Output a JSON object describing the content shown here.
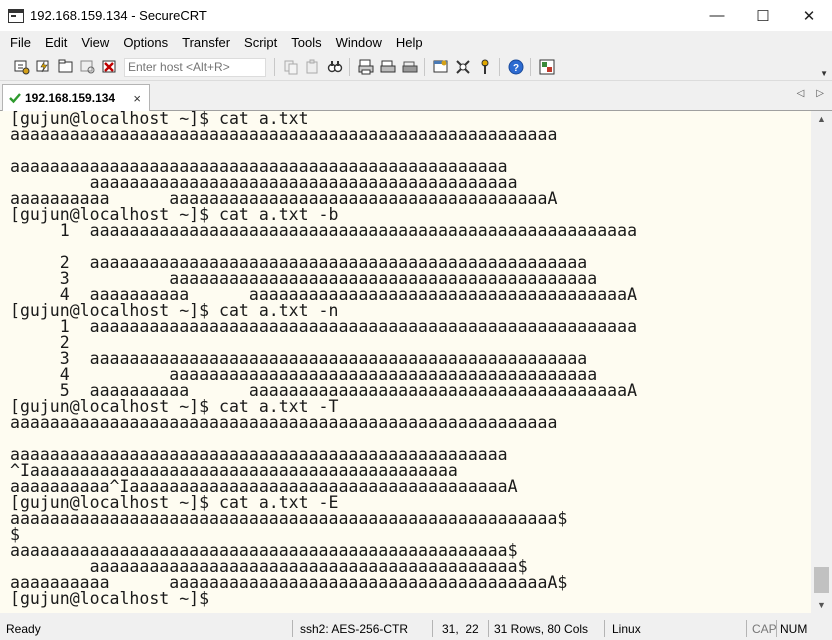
{
  "window": {
    "title": "192.168.159.134 - SecureCRT",
    "minimize": "—",
    "maximize": "☐",
    "close": "✕"
  },
  "menu": [
    "File",
    "Edit",
    "View",
    "Options",
    "Transfer",
    "Script",
    "Tools",
    "Window",
    "Help"
  ],
  "toolbar": {
    "host_placeholder": "Enter host <Alt+R>"
  },
  "tab": {
    "label": "192.168.159.134",
    "close": "×"
  },
  "terminal": {
    "lines": [
      "[gujun@localhost ~]$ cat a.txt",
      "aaaaaaaaaaaaaaaaaaaaaaaaaaaaaaaaaaaaaaaaaaaaaaaaaaaaaaa",
      "",
      "aaaaaaaaaaaaaaaaaaaaaaaaaaaaaaaaaaaaaaaaaaaaaaaaaa",
      "        aaaaaaaaaaaaaaaaaaaaaaaaaaaaaaaaaaaaaaaaaaa",
      "aaaaaaaaaa      aaaaaaaaaaaaaaaaaaaaaaaaaaaaaaaaaaaaaaA",
      "[gujun@localhost ~]$ cat a.txt -b",
      "     1  aaaaaaaaaaaaaaaaaaaaaaaaaaaaaaaaaaaaaaaaaaaaaaaaaaaaaaa",
      "",
      "     2  aaaaaaaaaaaaaaaaaaaaaaaaaaaaaaaaaaaaaaaaaaaaaaaaaa",
      "     3          aaaaaaaaaaaaaaaaaaaaaaaaaaaaaaaaaaaaaaaaaaa",
      "     4  aaaaaaaaaa      aaaaaaaaaaaaaaaaaaaaaaaaaaaaaaaaaaaaaaA",
      "[gujun@localhost ~]$ cat a.txt -n",
      "     1  aaaaaaaaaaaaaaaaaaaaaaaaaaaaaaaaaaaaaaaaaaaaaaaaaaaaaaa",
      "     2",
      "     3  aaaaaaaaaaaaaaaaaaaaaaaaaaaaaaaaaaaaaaaaaaaaaaaaaa",
      "     4          aaaaaaaaaaaaaaaaaaaaaaaaaaaaaaaaaaaaaaaaaaa",
      "     5  aaaaaaaaaa      aaaaaaaaaaaaaaaaaaaaaaaaaaaaaaaaaaaaaaA",
      "[gujun@localhost ~]$ cat a.txt -T",
      "aaaaaaaaaaaaaaaaaaaaaaaaaaaaaaaaaaaaaaaaaaaaaaaaaaaaaaa",
      "",
      "aaaaaaaaaaaaaaaaaaaaaaaaaaaaaaaaaaaaaaaaaaaaaaaaaa",
      "^Iaaaaaaaaaaaaaaaaaaaaaaaaaaaaaaaaaaaaaaaaaaa",
      "aaaaaaaaaa^IaaaaaaaaaaaaaaaaaaaaaaaaaaaaaaaaaaaaaaA",
      "[gujun@localhost ~]$ cat a.txt -E",
      "aaaaaaaaaaaaaaaaaaaaaaaaaaaaaaaaaaaaaaaaaaaaaaaaaaaaaaa$",
      "$",
      "aaaaaaaaaaaaaaaaaaaaaaaaaaaaaaaaaaaaaaaaaaaaaaaaaa$",
      "        aaaaaaaaaaaaaaaaaaaaaaaaaaaaaaaaaaaaaaaaaaa$",
      "aaaaaaaaaa      aaaaaaaaaaaaaaaaaaaaaaaaaaaaaaaaaaaaaaA$",
      "[gujun@localhost ~]$ "
    ]
  },
  "status": {
    "ready": "Ready",
    "encryption": "ssh2: AES-256-CTR",
    "cursor": "31,  22",
    "size": "31 Rows, 80 Cols",
    "terminal_type": "Linux",
    "cap": "CAP",
    "num": "NUM"
  },
  "colors": {
    "terminal_bg": "#fefcf1",
    "terminal_fg": "#1a1a1a",
    "chrome_bg": "#f0f0f0"
  }
}
